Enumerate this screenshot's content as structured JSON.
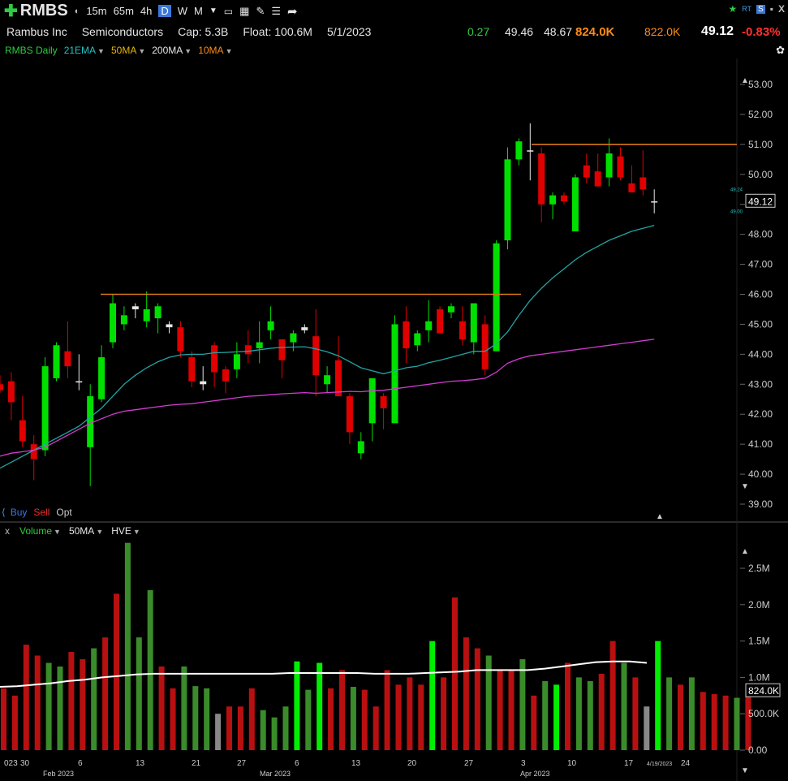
{
  "toolbar": {
    "symbol": "RMBS",
    "timeframes": [
      "15m",
      "65m",
      "4h",
      "D",
      "W",
      "M"
    ],
    "selected_timeframe": "D"
  },
  "info": {
    "company": "Rambus Inc",
    "sector": "Semiconductors",
    "cap": "Cap: 5.3B",
    "float": "Float: 100.6M",
    "date": "5/1/2023",
    "change": "0.27",
    "high": "49.46",
    "low": "48.67",
    "volume": "824.0K",
    "avg_volume": "822.0K",
    "price": "49.12",
    "pct_change": "-0.83%"
  },
  "indicators": {
    "title": "RMBS Daily",
    "items": [
      {
        "label": "21EMA",
        "color": "#21c4c4"
      },
      {
        "label": "50MA",
        "color": "#e6b800"
      },
      {
        "label": "200MA",
        "color": "#e6e6e6"
      },
      {
        "label": "10MA",
        "color": "#ff8c1a"
      }
    ]
  },
  "orders": {
    "buy": "Buy",
    "sell": "Sell",
    "opt": "Opt"
  },
  "volume_panel": {
    "close": "x",
    "label": "Volume",
    "ma": "50MA",
    "hve": "HVE"
  },
  "colors": {
    "up": "#00e000",
    "down": "#e00000",
    "doji": "#e6e6e6",
    "ema21": "#21a5a5",
    "ma50": "#d23cd2",
    "resistance": "#d87a1a",
    "vol_up": "#3a8c2a",
    "vol_down": "#b81010",
    "vol_hi_up": "#00ee00",
    "vol_gray": "#888888",
    "vol_avg": "#ffffff"
  },
  "chart_data": {
    "type": "candlestick",
    "price_axis": {
      "ylim": [
        38.6,
        53.6
      ],
      "ticks": [
        "53.00",
        "52.00",
        "51.00",
        "50.00",
        "49.00",
        "48.00",
        "47.00",
        "46.00",
        "45.00",
        "44.00",
        "43.00",
        "42.00",
        "41.00",
        "40.00",
        "39.00"
      ],
      "last_price": "49.12",
      "small_labels": [
        "49.24",
        "49.00"
      ]
    },
    "volume_axis": {
      "ylim": [
        0,
        3.0
      ],
      "ticks": [
        "2.5M",
        "2.0M",
        "1.5M",
        "1.0M",
        "500.0K",
        "0.00"
      ],
      "last_volume": "824.0K"
    },
    "x_axis": {
      "labels": [
        {
          "text": "023",
          "x": 5,
          "row": 1
        },
        {
          "text": "30",
          "x": 25,
          "row": 1
        },
        {
          "text": "Feb 2023",
          "x": 53,
          "row": 2
        },
        {
          "text": "6",
          "x": 96,
          "row": 1
        },
        {
          "text": "13",
          "x": 167,
          "row": 1
        },
        {
          "text": "21",
          "x": 236,
          "row": 1
        },
        {
          "text": "27",
          "x": 292,
          "row": 1
        },
        {
          "text": "Mar 2023",
          "x": 320,
          "row": 2
        },
        {
          "text": "6",
          "x": 363,
          "row": 1
        },
        {
          "text": "13",
          "x": 433,
          "row": 1
        },
        {
          "text": "20",
          "x": 502,
          "row": 1
        },
        {
          "text": "27",
          "x": 572,
          "row": 1
        },
        {
          "text": "3",
          "x": 642,
          "row": 1
        },
        {
          "text": "Apr 2023",
          "x": 641,
          "row": 2
        },
        {
          "text": "10",
          "x": 699,
          "row": 1
        },
        {
          "text": "17",
          "x": 769,
          "row": 1
        },
        {
          "text": "4/19/2023",
          "x": 797,
          "row": 1
        },
        {
          "text": "24",
          "x": 839,
          "row": 1
        }
      ]
    },
    "candles": [
      {
        "o": 43.0,
        "h": 43.3,
        "l": 42.7,
        "c": 42.8
      },
      {
        "o": 43.1,
        "h": 43.4,
        "l": 41.8,
        "c": 42.4
      },
      {
        "o": 41.8,
        "h": 42.6,
        "l": 40.9,
        "c": 41.1
      },
      {
        "o": 41.0,
        "h": 41.3,
        "l": 39.8,
        "c": 40.5
      },
      {
        "o": 40.8,
        "h": 43.9,
        "l": 40.6,
        "c": 43.6
      },
      {
        "o": 43.2,
        "h": 44.4,
        "l": 43.1,
        "c": 44.3
      },
      {
        "o": 44.1,
        "h": 45.1,
        "l": 43.2,
        "c": 43.6
      },
      {
        "o": 43.1,
        "h": 44.0,
        "l": 42.8,
        "c": 43.1
      },
      {
        "o": 40.9,
        "h": 43.0,
        "l": 39.6,
        "c": 42.6
      },
      {
        "o": 42.5,
        "h": 44.3,
        "l": 42.4,
        "c": 43.9
      },
      {
        "o": 44.4,
        "h": 46.0,
        "l": 44.2,
        "c": 45.7
      },
      {
        "o": 45.0,
        "h": 45.6,
        "l": 44.8,
        "c": 45.3
      },
      {
        "o": 45.6,
        "h": 45.7,
        "l": 45.2,
        "c": 45.5
      },
      {
        "o": 45.1,
        "h": 46.1,
        "l": 44.9,
        "c": 45.5
      },
      {
        "o": 45.2,
        "h": 45.7,
        "l": 44.7,
        "c": 45.6
      },
      {
        "o": 45.0,
        "h": 45.1,
        "l": 44.7,
        "c": 44.9
      },
      {
        "o": 44.9,
        "h": 45.1,
        "l": 43.9,
        "c": 44.1
      },
      {
        "o": 43.9,
        "h": 44.1,
        "l": 42.9,
        "c": 43.1
      },
      {
        "o": 43.1,
        "h": 43.6,
        "l": 42.8,
        "c": 43.0
      },
      {
        "o": 44.3,
        "h": 44.4,
        "l": 42.9,
        "c": 43.4
      },
      {
        "o": 43.5,
        "h": 43.6,
        "l": 42.7,
        "c": 43.1
      },
      {
        "o": 43.5,
        "h": 44.4,
        "l": 43.2,
        "c": 44.0
      },
      {
        "o": 44.3,
        "h": 44.8,
        "l": 43.7,
        "c": 44.0
      },
      {
        "o": 44.2,
        "h": 45.1,
        "l": 43.7,
        "c": 44.4
      },
      {
        "o": 44.8,
        "h": 45.6,
        "l": 44.5,
        "c": 45.1
      },
      {
        "o": 44.5,
        "h": 44.5,
        "l": 43.2,
        "c": 43.8
      },
      {
        "o": 44.4,
        "h": 44.8,
        "l": 44.1,
        "c": 44.7
      },
      {
        "o": 44.8,
        "h": 45.0,
        "l": 44.7,
        "c": 44.9
      },
      {
        "o": 44.6,
        "h": 45.5,
        "l": 42.6,
        "c": 43.3
      },
      {
        "o": 43.0,
        "h": 43.6,
        "l": 42.7,
        "c": 43.3
      },
      {
        "o": 43.8,
        "h": 44.6,
        "l": 42.6,
        "c": 42.6
      },
      {
        "o": 42.6,
        "h": 42.7,
        "l": 41.0,
        "c": 41.4
      },
      {
        "o": 40.7,
        "h": 41.4,
        "l": 40.5,
        "c": 41.1
      },
      {
        "o": 41.7,
        "h": 43.2,
        "l": 41.1,
        "c": 43.2
      },
      {
        "o": 42.6,
        "h": 42.7,
        "l": 41.5,
        "c": 42.2
      },
      {
        "o": 41.7,
        "h": 45.3,
        "l": 41.7,
        "c": 45.0
      },
      {
        "o": 45.1,
        "h": 45.6,
        "l": 43.7,
        "c": 44.2
      },
      {
        "o": 44.3,
        "h": 44.8,
        "l": 44.1,
        "c": 44.7
      },
      {
        "o": 44.8,
        "h": 45.8,
        "l": 44.4,
        "c": 45.1
      },
      {
        "o": 45.5,
        "h": 45.6,
        "l": 44.7,
        "c": 44.7
      },
      {
        "o": 45.4,
        "h": 45.7,
        "l": 45.2,
        "c": 45.6
      },
      {
        "o": 45.1,
        "h": 45.6,
        "l": 44.3,
        "c": 44.5
      },
      {
        "o": 44.4,
        "h": 45.7,
        "l": 44.0,
        "c": 45.7
      },
      {
        "o": 45.0,
        "h": 45.3,
        "l": 43.3,
        "c": 43.5
      },
      {
        "o": 44.1,
        "h": 47.8,
        "l": 44.1,
        "c": 47.7
      },
      {
        "o": 47.8,
        "h": 50.9,
        "l": 47.5,
        "c": 50.5
      },
      {
        "o": 50.5,
        "h": 51.2,
        "l": 50.3,
        "c": 51.1
      },
      {
        "o": 50.8,
        "h": 51.7,
        "l": 49.8,
        "c": 50.8
      },
      {
        "o": 50.7,
        "h": 50.9,
        "l": 48.4,
        "c": 49.0
      },
      {
        "o": 49.0,
        "h": 49.4,
        "l": 48.5,
        "c": 49.3
      },
      {
        "o": 49.3,
        "h": 49.4,
        "l": 49.0,
        "c": 49.1
      },
      {
        "o": 48.1,
        "h": 50.0,
        "l": 48.1,
        "c": 49.9
      },
      {
        "o": 50.3,
        "h": 50.7,
        "l": 49.7,
        "c": 49.9
      },
      {
        "o": 50.1,
        "h": 50.7,
        "l": 49.6,
        "c": 49.6
      },
      {
        "o": 49.9,
        "h": 51.2,
        "l": 49.6,
        "c": 50.7
      },
      {
        "o": 50.6,
        "h": 50.9,
        "l": 49.8,
        "c": 49.9
      },
      {
        "o": 49.7,
        "h": 50.3,
        "l": 49.4,
        "c": 49.4
      },
      {
        "o": 49.9,
        "h": 50.8,
        "l": 49.3,
        "c": 49.5
      },
      {
        "o": 49.1,
        "h": 49.5,
        "l": 48.7,
        "c": 49.1
      }
    ],
    "volume": [
      {
        "v": 0.85,
        "c": "down"
      },
      {
        "v": 0.75,
        "c": "down"
      },
      {
        "v": 1.45,
        "c": "down"
      },
      {
        "v": 1.3,
        "c": "down"
      },
      {
        "v": 1.2,
        "c": "up"
      },
      {
        "v": 1.15,
        "c": "up"
      },
      {
        "v": 1.35,
        "c": "down"
      },
      {
        "v": 1.25,
        "c": "down"
      },
      {
        "v": 1.4,
        "c": "up"
      },
      {
        "v": 1.55,
        "c": "down"
      },
      {
        "v": 2.15,
        "c": "down"
      },
      {
        "v": 2.85,
        "c": "up"
      },
      {
        "v": 1.55,
        "c": "up"
      },
      {
        "v": 2.2,
        "c": "up"
      },
      {
        "v": 1.15,
        "c": "down"
      },
      {
        "v": 0.85,
        "c": "down"
      },
      {
        "v": 1.15,
        "c": "up"
      },
      {
        "v": 0.88,
        "c": "up"
      },
      {
        "v": 0.85,
        "c": "up"
      },
      {
        "v": 0.5,
        "c": "gray"
      },
      {
        "v": 0.6,
        "c": "down"
      },
      {
        "v": 0.6,
        "c": "down"
      },
      {
        "v": 0.85,
        "c": "down"
      },
      {
        "v": 0.55,
        "c": "up"
      },
      {
        "v": 0.45,
        "c": "up"
      },
      {
        "v": 0.6,
        "c": "up"
      },
      {
        "v": 1.22,
        "c": "hi"
      },
      {
        "v": 0.83,
        "c": "up"
      },
      {
        "v": 1.2,
        "c": "hi"
      },
      {
        "v": 0.85,
        "c": "down"
      },
      {
        "v": 1.1,
        "c": "down"
      },
      {
        "v": 0.87,
        "c": "up"
      },
      {
        "v": 0.83,
        "c": "down"
      },
      {
        "v": 0.6,
        "c": "down"
      },
      {
        "v": 1.1,
        "c": "down"
      },
      {
        "v": 0.9,
        "c": "down"
      },
      {
        "v": 1.0,
        "c": "down"
      },
      {
        "v": 0.9,
        "c": "down"
      },
      {
        "v": 1.5,
        "c": "hi"
      },
      {
        "v": 1.0,
        "c": "down"
      },
      {
        "v": 2.1,
        "c": "down"
      },
      {
        "v": 1.55,
        "c": "down"
      },
      {
        "v": 1.4,
        "c": "down"
      },
      {
        "v": 1.3,
        "c": "up"
      },
      {
        "v": 1.1,
        "c": "down"
      },
      {
        "v": 1.1,
        "c": "down"
      },
      {
        "v": 1.25,
        "c": "up"
      },
      {
        "v": 0.75,
        "c": "down"
      },
      {
        "v": 0.95,
        "c": "up"
      },
      {
        "v": 0.9,
        "c": "hi"
      },
      {
        "v": 1.2,
        "c": "down"
      },
      {
        "v": 1.0,
        "c": "up"
      },
      {
        "v": 0.95,
        "c": "up"
      },
      {
        "v": 1.05,
        "c": "down"
      },
      {
        "v": 1.5,
        "c": "down"
      },
      {
        "v": 1.2,
        "c": "up"
      },
      {
        "v": 1.0,
        "c": "down"
      },
      {
        "v": 0.6,
        "c": "gray"
      },
      {
        "v": 1.5,
        "c": "hi"
      },
      {
        "v": 1.0,
        "c": "up"
      },
      {
        "v": 0.9,
        "c": "down"
      },
      {
        "v": 1.0,
        "c": "up"
      },
      {
        "v": 0.8,
        "c": "down"
      },
      {
        "v": 0.77,
        "c": "down"
      },
      {
        "v": 0.75,
        "c": "down"
      },
      {
        "v": 0.72,
        "c": "up"
      },
      {
        "v": 0.82,
        "c": "down"
      }
    ],
    "ema21": [
      40.2,
      40.4,
      40.6,
      40.8,
      41.0,
      41.2,
      41.4,
      41.6,
      41.9,
      42.2,
      42.6,
      43.0,
      43.3,
      43.55,
      43.75,
      43.9,
      43.98,
      44.0,
      44.0,
      44.05,
      44.06,
      44.08,
      44.1,
      44.15,
      44.2,
      44.23,
      44.24,
      44.25,
      44.18,
      44.08,
      43.95,
      43.75,
      43.55,
      43.45,
      43.35,
      43.45,
      43.55,
      43.6,
      43.72,
      43.8,
      43.9,
      44.0,
      44.1,
      44.1,
      44.35,
      44.75,
      45.3,
      45.8,
      46.2,
      46.55,
      46.85,
      47.15,
      47.4,
      47.6,
      47.8,
      47.95,
      48.1,
      48.2,
      48.3
    ],
    "ma50": [
      40.6,
      40.7,
      40.75,
      40.8,
      40.9,
      41.1,
      41.3,
      41.5,
      41.7,
      41.85,
      42.0,
      42.1,
      42.15,
      42.2,
      42.25,
      42.3,
      42.33,
      42.35,
      42.4,
      42.45,
      42.5,
      42.55,
      42.6,
      42.62,
      42.65,
      42.68,
      42.7,
      42.72,
      42.7,
      42.72,
      42.74,
      42.76,
      42.75,
      42.78,
      42.8,
      42.85,
      42.9,
      42.95,
      43.0,
      43.05,
      43.1,
      43.12,
      43.15,
      43.2,
      43.4,
      43.7,
      43.85,
      43.95,
      44.0,
      44.05,
      44.1,
      44.15,
      44.2,
      44.25,
      44.3,
      44.35,
      44.4,
      44.45,
      44.5
    ],
    "vol_avg": [
      0.87,
      0.88,
      0.9,
      0.92,
      0.95,
      0.97,
      1.0,
      1.02,
      1.04,
      1.05,
      1.05,
      1.05,
      1.05,
      1.05,
      1.05,
      1.05,
      1.05,
      1.06,
      1.06,
      1.06,
      1.06,
      1.06,
      1.05,
      1.05,
      1.05,
      1.06,
      1.07,
      1.08,
      1.1,
      1.1,
      1.1,
      1.1,
      1.12,
      1.15,
      1.18,
      1.21,
      1.22,
      1.22,
      1.2
    ],
    "resistance": [
      {
        "price": 46.0,
        "x1": 124,
        "x2": 642
      },
      {
        "price": 51.0,
        "x1": 655,
        "x2": 908
      }
    ]
  }
}
